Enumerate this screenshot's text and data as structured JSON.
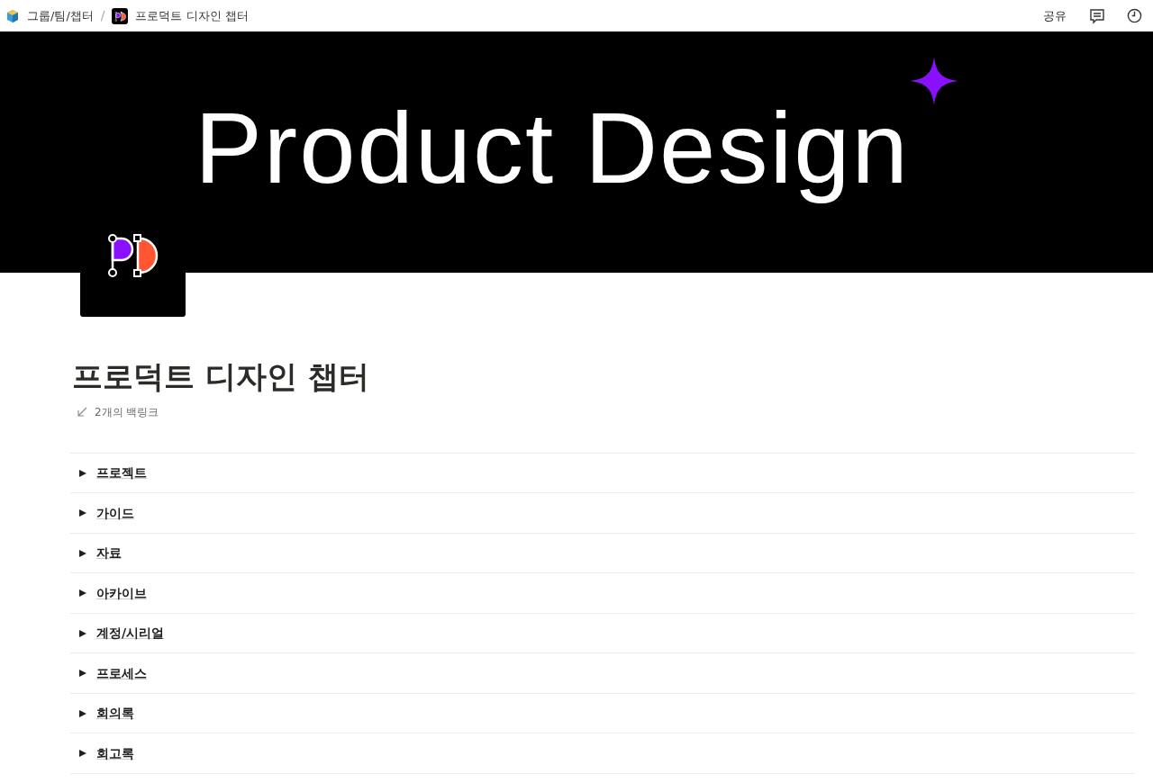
{
  "breadcrumbs": [
    {
      "label": "그룹/팀/챕터"
    },
    {
      "label": "프로덕트 디자인 챕터"
    }
  ],
  "breadcrumb_separator": "/",
  "topbar": {
    "share": "공유"
  },
  "cover": {
    "title": "Product Design"
  },
  "page": {
    "title": "프로덕트 디자인 챕터",
    "backlinks": "2개의 백링크"
  },
  "toggles": [
    {
      "label": "프로젝트",
      "expanded": false
    },
    {
      "label": "가이드",
      "expanded": false
    },
    {
      "label": "자료",
      "expanded": false
    },
    {
      "label": "아카이브",
      "expanded": false
    },
    {
      "label": "계정/시리얼",
      "expanded": false
    },
    {
      "label": "프로세스",
      "expanded": false
    },
    {
      "label": "회의록",
      "expanded": false
    },
    {
      "label": "회고록",
      "expanded": false
    }
  ]
}
